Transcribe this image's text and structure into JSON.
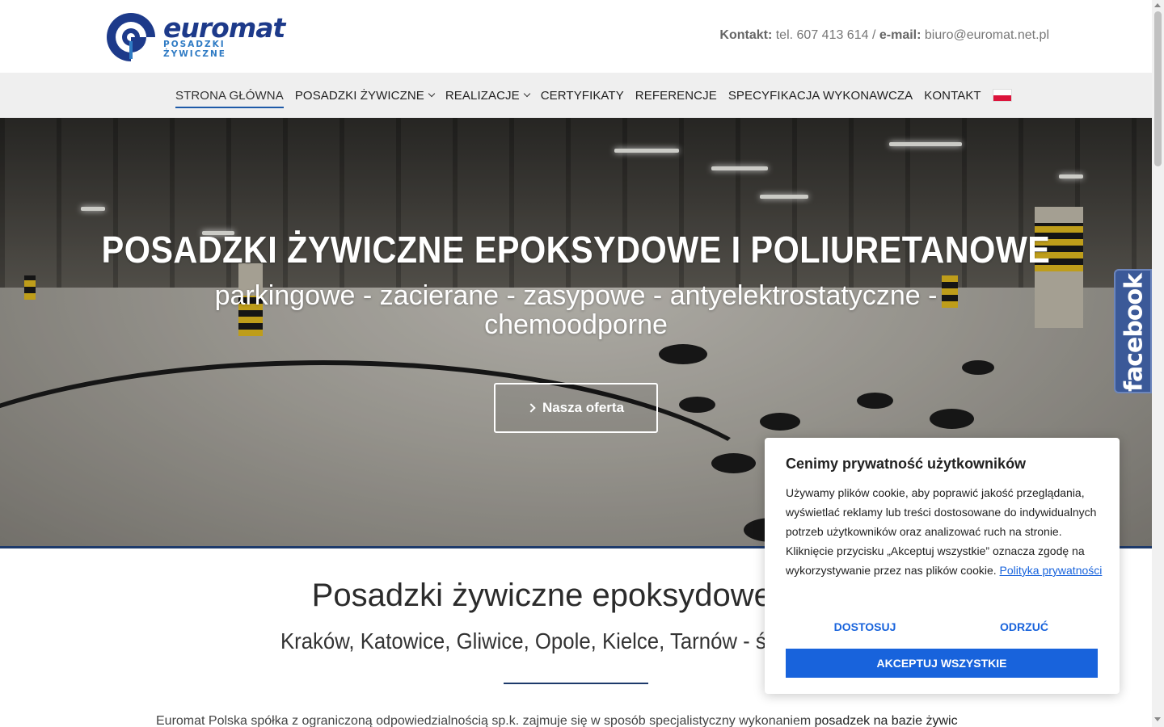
{
  "header": {
    "logo_word": "euromat",
    "logo_sub": "POSADZKI ŻYWICZNE",
    "contact_label": "Kontakt:",
    "contact_phone": "tel. 607 413 614",
    "contact_sep": "/",
    "email_label": "e-mail:",
    "email": "biuro@euromat.net.pl"
  },
  "nav": {
    "items": [
      {
        "label": "STRONA GŁÓWNA"
      },
      {
        "label": "POSADZKI ŻYWICZNE"
      },
      {
        "label": "REALIZACJE"
      },
      {
        "label": "CERTYFIKATY"
      },
      {
        "label": "REFERENCJE"
      },
      {
        "label": "SPECYFIKACJA WYKONAWCZA"
      },
      {
        "label": "KONTAKT"
      }
    ]
  },
  "hero": {
    "title": "POSADZKI ŻYWICZNE EPOKSYDOWE I POLIURETANOWE",
    "subtitle": "parkingowe - zacierane - zasypowe - antyelektrostatyczne - chemoodporne",
    "button_label": "Nasza oferta"
  },
  "facebook": {
    "label": "facebook"
  },
  "main": {
    "title": "Posadzki żywiczne epoksydowe i pol",
    "subtitle": "Kraków, Katowice, Gliwice, Opole, Kielce, Tarnów - śląskie - mał",
    "intro_plain": "Euromat Polska spółka z ograniczoną odpowiedzialnością sp.k. zajmuje się w sposób specjalistyczny wykonaniem ",
    "intro_bold": "posadzek na bazie żywic"
  },
  "cookie": {
    "title": "Cenimy prywatność użytkowników",
    "text": "Używamy plików cookie, aby poprawić jakość przeglądania, wyświetlać reklamy lub treści dostosowane do indywidualnych potrzeb użytkowników oraz analizować ruch na stronie. Kliknięcie przycisku „Akceptuj wszystkie” oznacza zgodę na wykorzystywanie przez nas plików cookie. ",
    "link": "Polityka prywatności",
    "customize": "DOSTOSUJ",
    "reject": "ODRZUĆ",
    "accept": "AKCEPTUJ WSZYSTKIE"
  },
  "colors": {
    "brand_blue": "#1d3a8a",
    "accent_blue": "#1863dc",
    "facebook_blue": "#3b5998"
  }
}
